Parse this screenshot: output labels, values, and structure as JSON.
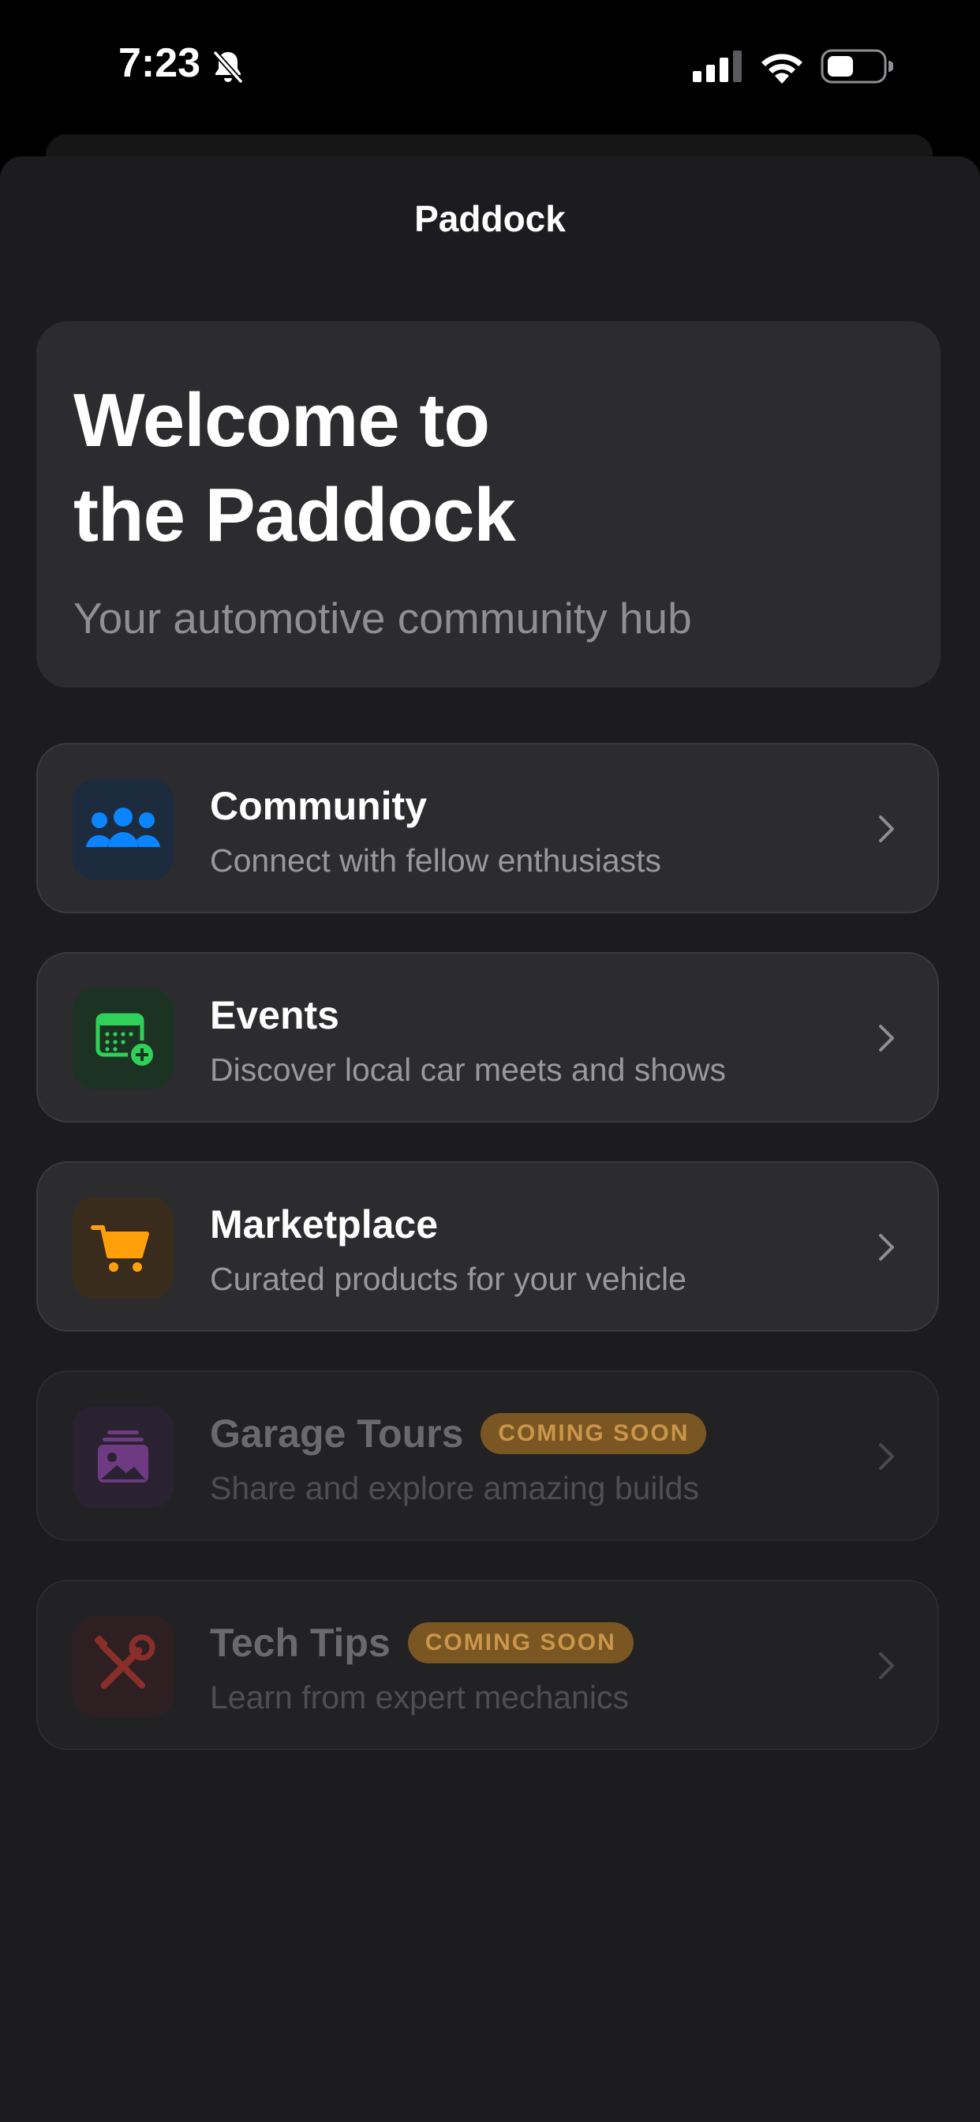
{
  "status_bar": {
    "time": "7:23",
    "icons": [
      "bell-slash-icon",
      "cellular-signal-icon",
      "wifi-icon",
      "battery-icon"
    ]
  },
  "nav": {
    "title": "Paddock"
  },
  "hero": {
    "title_line1": "Welcome to",
    "title_line2": "the Paddock",
    "subtitle": "Your automotive community hub"
  },
  "features": [
    {
      "title": "Community",
      "description": "Connect with fellow enthusiasts",
      "icon": "people-icon",
      "accent": "#0a84ff",
      "enabled": true
    },
    {
      "title": "Events",
      "description": "Discover local car meets and shows",
      "icon": "calendar-plus-icon",
      "accent": "#30d158",
      "enabled": true
    },
    {
      "title": "Marketplace",
      "description": "Curated products for your vehicle",
      "icon": "cart-icon",
      "accent": "#ff9f0a",
      "enabled": true
    },
    {
      "title": "Garage Tours",
      "description": "Share and explore amazing builds",
      "icon": "photo-stack-icon",
      "accent": "#bf5af2",
      "enabled": false,
      "badge": "COMING SOON"
    },
    {
      "title": "Tech Tips",
      "description": "Learn from expert mechanics",
      "icon": "wrench-screwdriver-icon",
      "accent": "#ff453a",
      "enabled": false,
      "badge": "COMING SOON"
    }
  ],
  "colors": {
    "background": "#1c1c1e",
    "card": "#2c2c2e",
    "badge_bg": "#7a5622",
    "badge_text": "#c9964a"
  }
}
